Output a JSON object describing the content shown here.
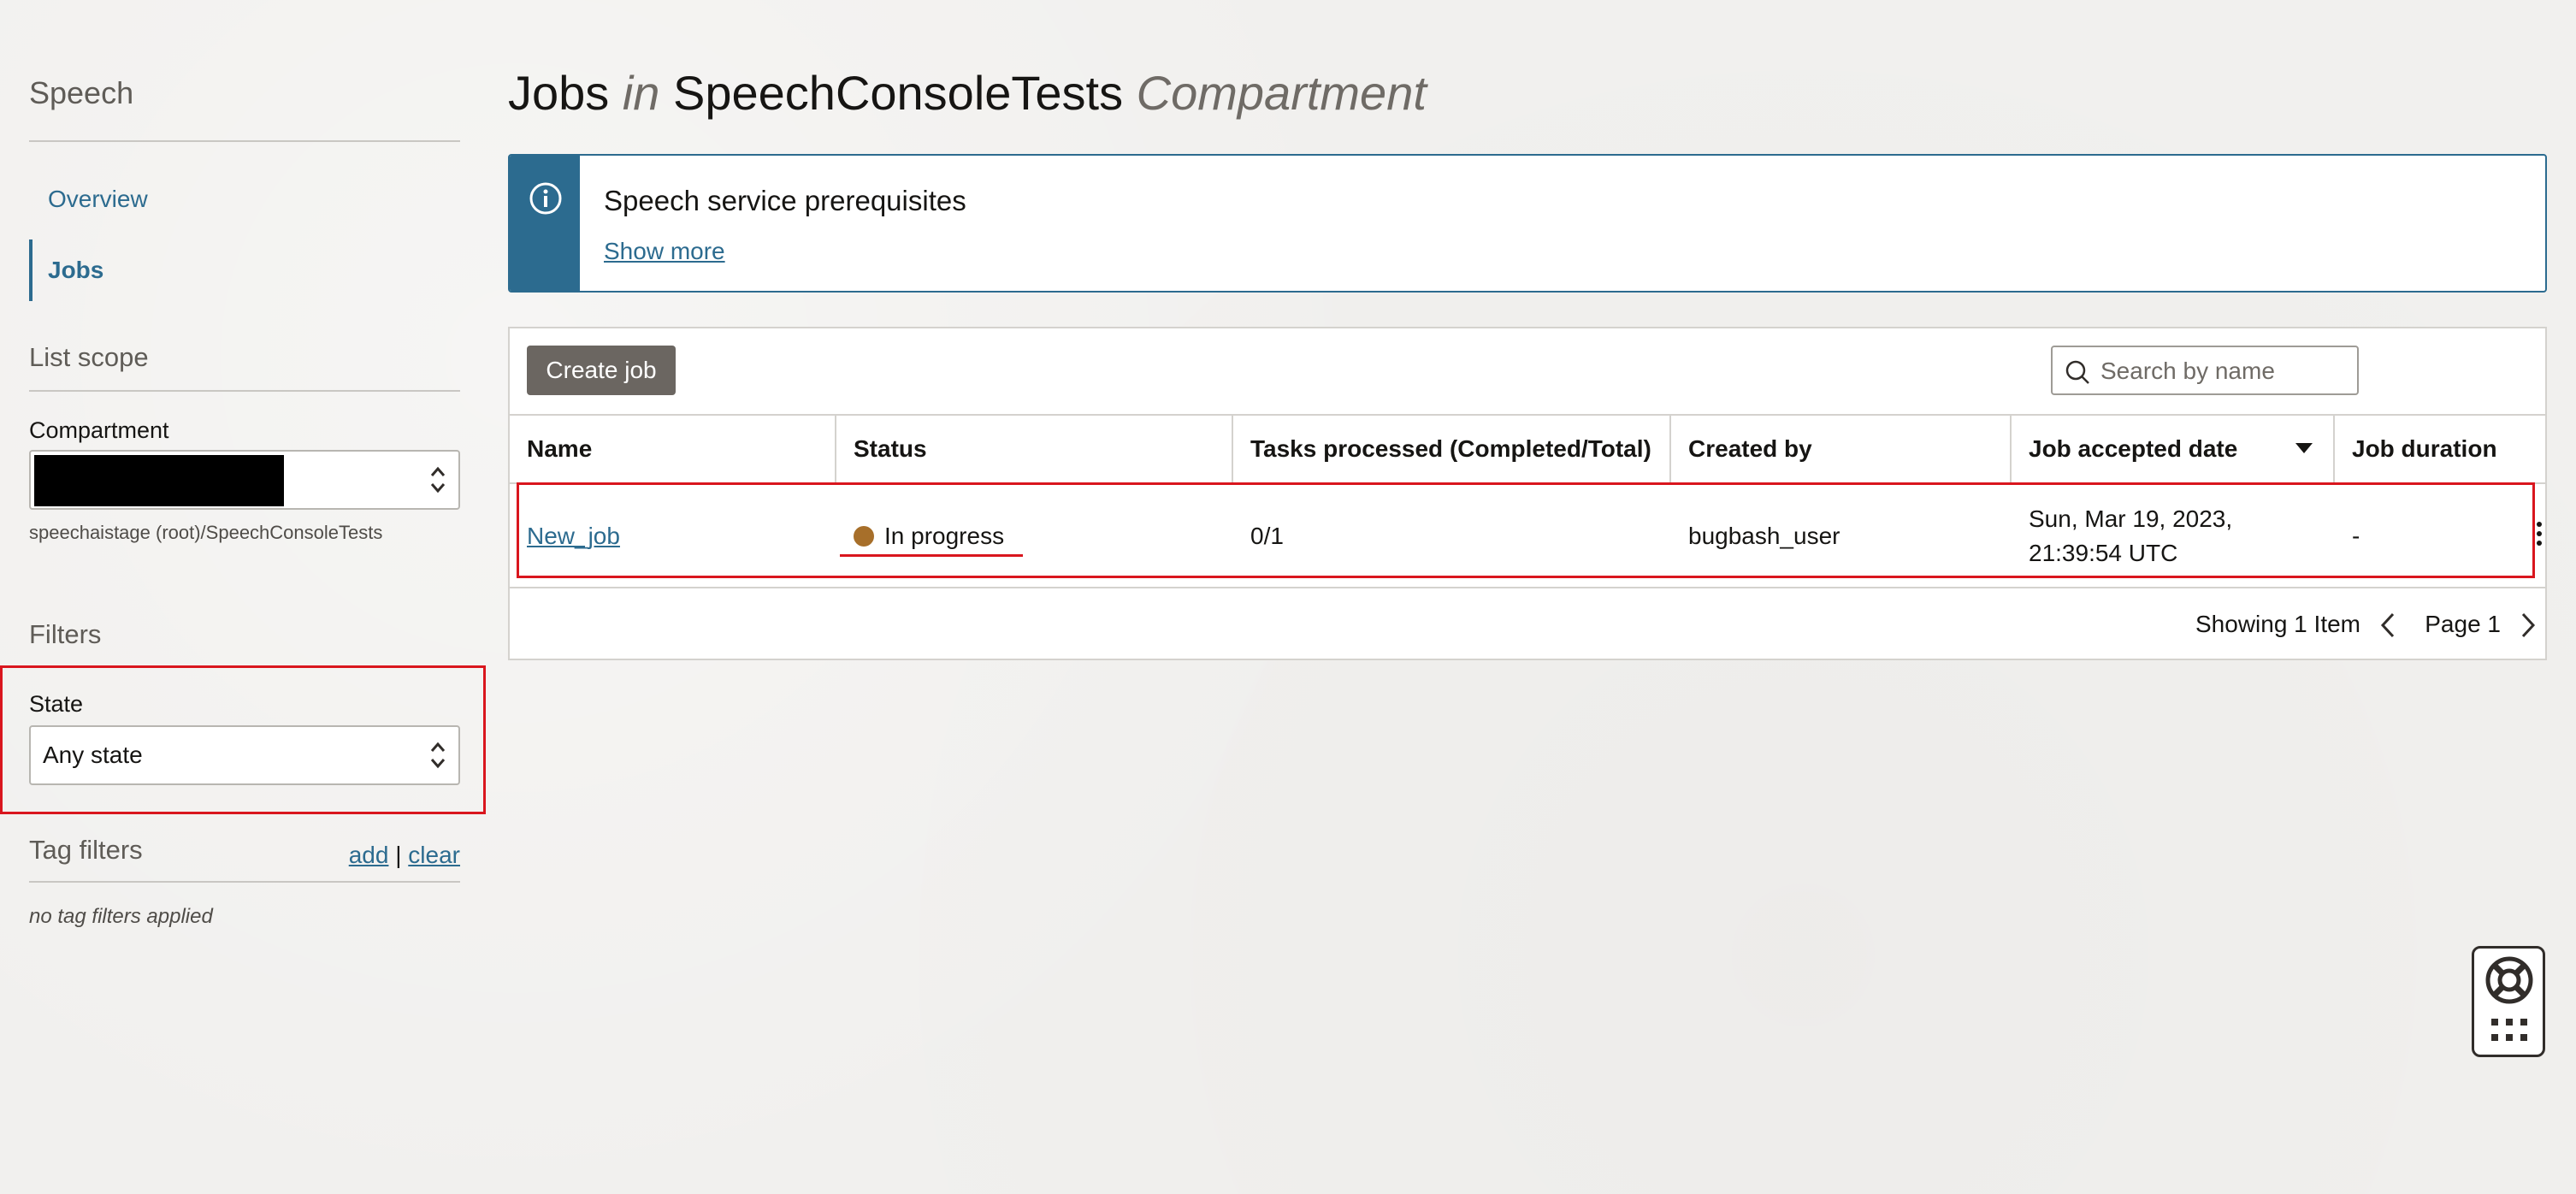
{
  "sidebar": {
    "title": "Speech",
    "nav": [
      {
        "label": "Overview",
        "active": false
      },
      {
        "label": "Jobs",
        "active": true
      }
    ],
    "list_scope": {
      "title": "List scope",
      "compartment_label": "Compartment",
      "compartment_path": "speechaistage (root)/SpeechConsoleTests"
    },
    "filters": {
      "title": "Filters",
      "state_label": "State",
      "state_value": "Any state"
    },
    "tag_filters": {
      "title": "Tag filters",
      "add_label": "add",
      "separator": "|",
      "clear_label": "clear",
      "empty_text": "no tag filters applied"
    }
  },
  "header": {
    "title_main": "Jobs",
    "title_in": "in",
    "compartment_name": "SpeechConsoleTests",
    "title_suffix": "Compartment"
  },
  "banner": {
    "icon": "info-icon",
    "title": "Speech service prerequisites",
    "link": "Show more"
  },
  "toolbar": {
    "create_label": "Create job",
    "search_placeholder": "Search by name"
  },
  "table": {
    "columns": [
      "Name",
      "Status",
      "Tasks processed (Completed/Total)",
      "Created by",
      "Job accepted date",
      "Job duration"
    ],
    "rows": [
      {
        "name": "New_job",
        "status": "In progress",
        "status_color": "#a76f2a",
        "tasks": "0/1",
        "created_by": "bugbash_user",
        "accepted_date_line1": "Sun, Mar 19, 2023,",
        "accepted_date_line2": "21:39:54 UTC",
        "duration": "-"
      }
    ],
    "footer": {
      "showing": "Showing 1 Item",
      "page": "Page 1"
    }
  },
  "colors": {
    "accent": "#2c6b8f",
    "button": "#6b6661",
    "highlight": "#d9161e"
  }
}
